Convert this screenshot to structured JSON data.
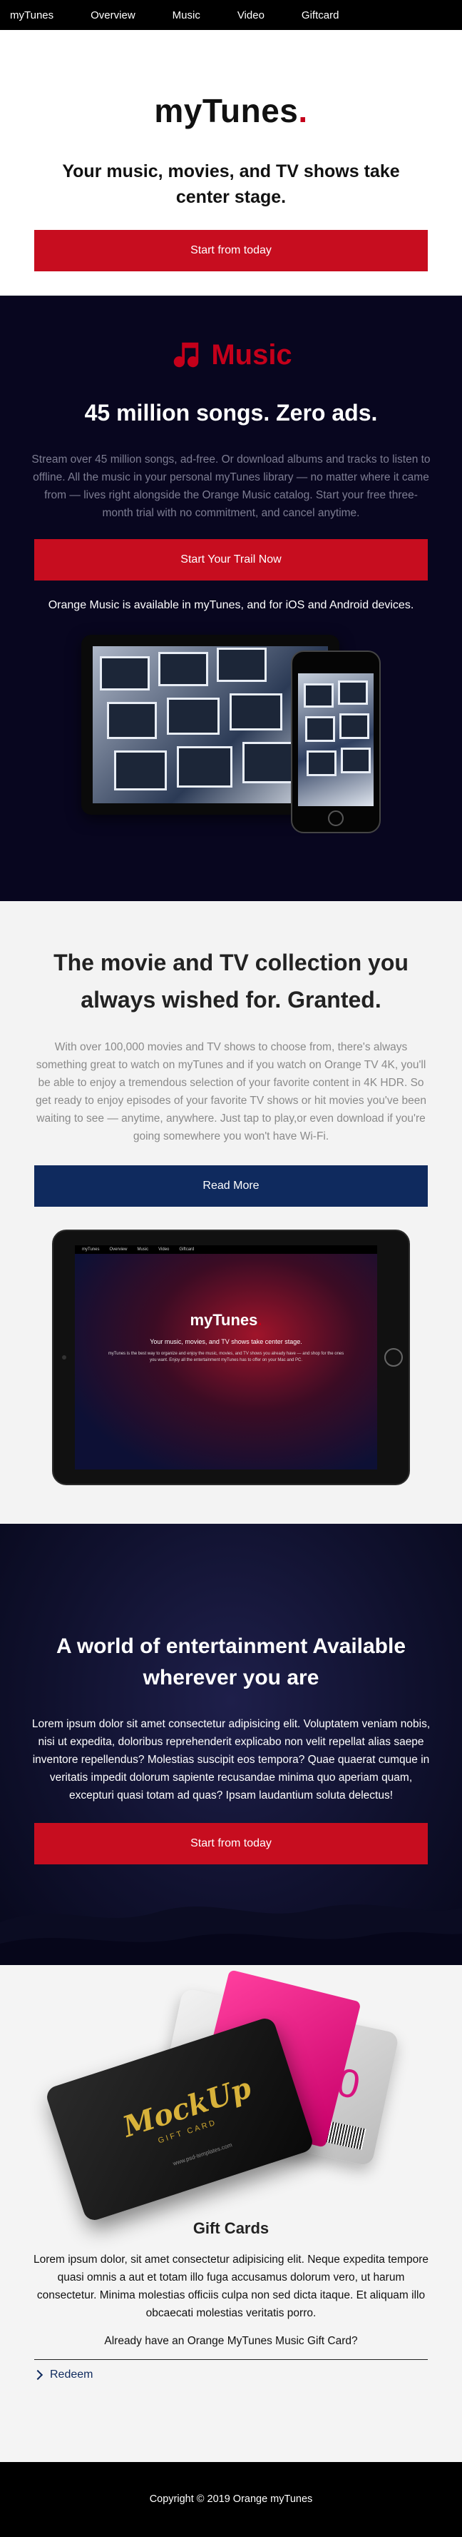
{
  "nav": {
    "items": [
      "myTunes",
      "Overview",
      "Music",
      "Video",
      "Giftcard"
    ]
  },
  "hero": {
    "logo_text": "myTunes",
    "logo_dot": ".",
    "tagline": "Your music, movies, and TV shows take center stage.",
    "cta": "Start from today"
  },
  "music": {
    "brand": "Music",
    "heading": "45 million songs. Zero ads.",
    "body": "Stream over 45 million songs, ad-free. Or download albums and tracks to listen to offline. All the music in your personal myTunes library — no matter where it came from — lives right alongside the Orange Music catalog. Start your free three-month trial with no commitment, and cancel anytime.",
    "cta": "Start Your Trail Now",
    "availability": "Orange Music is available in myTunes, and for iOS and Android devices."
  },
  "movies": {
    "heading": "The movie and TV collection you always wished for. Granted.",
    "body": "With over 100,000 movies and TV shows to choose from, there's always something great to watch on myTunes and if you watch on Orange TV 4K, you'll be able to enjoy a tremendous selection of your favorite content in 4K HDR. So get ready to enjoy episodes of your favorite TV shows or hit movies you've been waiting to see — anytime, anywhere. Just tap to play,or even download if you're going somewhere you won't have Wi-Fi.",
    "cta": "Read More",
    "screen": {
      "nav": [
        "myTunes",
        "Overview",
        "Music",
        "Video",
        "Giftcard"
      ],
      "logo": "myTunes",
      "tagline": "Your music, movies, and TV shows take center stage.",
      "small": "myTunes is the best way to organize and enjoy the music, movies, and TV shows you already have — and shop for the ones you want. Enjoy all the entertainment myTunes has to offer on your Mac and PC."
    }
  },
  "world": {
    "heading": "A world of entertainment Available wherever you are",
    "body": "Lorem ipsum dolor sit amet consectetur adipisicing elit. Voluptatem veniam nobis, nisi ut expedita, doloribus reprehenderit explicabo non velit repellat alias saepe inventore repellendus? Molestias suscipit eos tempora? Quae quaerat cumque in veritatis impedit dolorum sapiente recusandae minima quo aperiam quam, excepturi quasi totam ad quas? Ipsam laudantium soluta delectus!",
    "cta": "Start from today"
  },
  "gift": {
    "card_brand": "MockUp",
    "card_label": "GIFT CARD",
    "card_url": "www.psd-templates.com",
    "card_back_text": "00",
    "heading": "Gift Cards",
    "body": "Lorem ipsum dolor, sit amet consectetur adipisicing elit. Neque expedita tempore quasi omnis a aut et totam illo fuga accusamus dolorum vero, ut harum consectetur. Minima molestias officiis culpa non sed dicta itaque. Et aliquam illo obcaecati molestias veritatis porro.",
    "question": "Already have an Orange MyTunes Music Gift Card?",
    "redeem": "Redeem"
  },
  "footer": {
    "copyright": "Copyright © 2019 Orange myTunes"
  },
  "colors": {
    "accent_red": "#c70d1f",
    "navy": "#0f2a5e",
    "music_bg": "#08061f",
    "world_bg": "#10112e"
  }
}
